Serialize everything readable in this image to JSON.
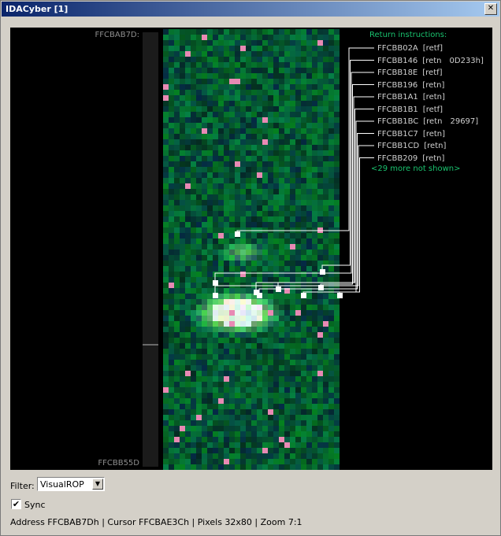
{
  "window": {
    "title": "IDACyber [1]",
    "close_glyph": "✕"
  },
  "canvas": {
    "top_address": "FFCBAB7D:",
    "bottom_address": "FFCBB55D",
    "colors": {
      "background": "#000000",
      "pixel_base": "#0b4a2a",
      "highlight": "#ffffff",
      "pink": "#e88ab4",
      "accent_text": "#19c26e"
    }
  },
  "returns": {
    "title": "Return instructions:",
    "items": [
      {
        "addr": "FFCBB02A",
        "ins": "[retf]",
        "extra": ""
      },
      {
        "addr": "FFCBB146",
        "ins": "[retn",
        "extra": "0D233h]"
      },
      {
        "addr": "FFCBB18E",
        "ins": "[retf]",
        "extra": ""
      },
      {
        "addr": "FFCBB196",
        "ins": "[retn]",
        "extra": ""
      },
      {
        "addr": "FFCBB1A1",
        "ins": "[retn]",
        "extra": ""
      },
      {
        "addr": "FFCBB1B1",
        "ins": "[retf]",
        "extra": ""
      },
      {
        "addr": "FFCBB1BC",
        "ins": "[retn",
        "extra": "29697]"
      },
      {
        "addr": "FFCBB1C7",
        "ins": "[retn]",
        "extra": ""
      },
      {
        "addr": "FFCBB1CD",
        "ins": "[retn]",
        "extra": ""
      },
      {
        "addr": "FFCBB209",
        "ins": "[retn]",
        "extra": ""
      }
    ],
    "more": "<29 more not shown>"
  },
  "filter": {
    "label": "Filter:",
    "value": "VisualROP"
  },
  "sync": {
    "label": "Sync",
    "checked": true,
    "check_glyph": "✔"
  },
  "status": "Address FFCBAB7Dh | Cursor FFCBAE3Ch | Pixels 32x80  | Zoom 7:1"
}
